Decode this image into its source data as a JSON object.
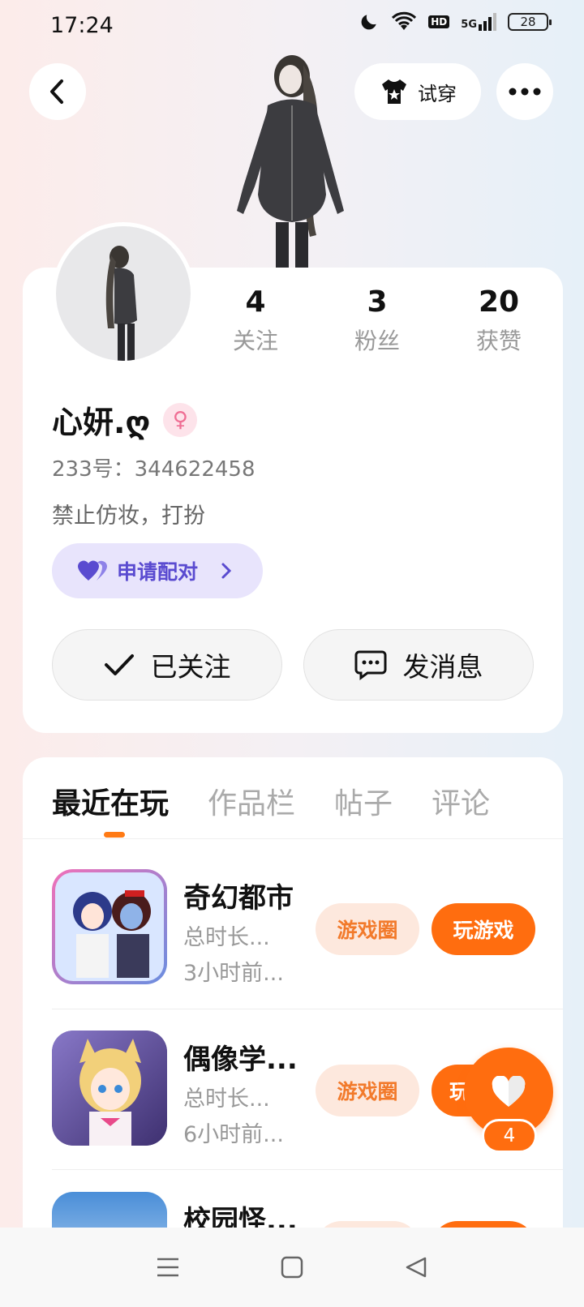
{
  "status_bar": {
    "time": "17:24",
    "battery": "28",
    "network": "5G",
    "hd": "HD"
  },
  "header": {
    "tryon_label": "试穿"
  },
  "profile": {
    "stats": [
      {
        "value": "4",
        "label": "关注"
      },
      {
        "value": "3",
        "label": "粉丝"
      },
      {
        "value": "20",
        "label": "获赞"
      }
    ],
    "username": "心妍.ღ",
    "gender_icon": "♀",
    "user_id": "233号：344622458",
    "bio": "禁止仿妆，打扮",
    "pair_label": "申请配对",
    "follow_label": "已关注",
    "message_label": "发消息"
  },
  "tabs": [
    "最近在玩",
    "作品栏",
    "帖子",
    "评论"
  ],
  "games": [
    {
      "name": "奇幻都市",
      "duration": "总时长...",
      "last_played": "3小时前...",
      "circle_label": "游戏圈",
      "play_label": "玩游戏"
    },
    {
      "name": "偶像学...",
      "duration": "总时长...",
      "last_played": "6小时前...",
      "circle_label": "游戏圈",
      "play_label": "玩"
    },
    {
      "name": "校园怪..."
    }
  ],
  "like_fab": {
    "count": "4"
  },
  "colors": {
    "accent": "#ff6d0f",
    "pair": "#5a4bd0"
  }
}
